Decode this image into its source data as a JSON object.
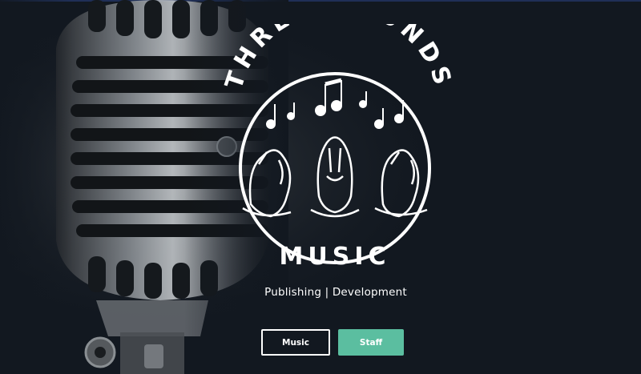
{
  "brand": {
    "arc_text": "THREE HOUNDS",
    "bottom_text": "MUSIC",
    "tagline": "Publishing | Development"
  },
  "buttons": {
    "music": "Music",
    "staff": "Staff"
  },
  "colors": {
    "background": "#121820",
    "accent": "#5bbea0",
    "text": "#ffffff"
  }
}
